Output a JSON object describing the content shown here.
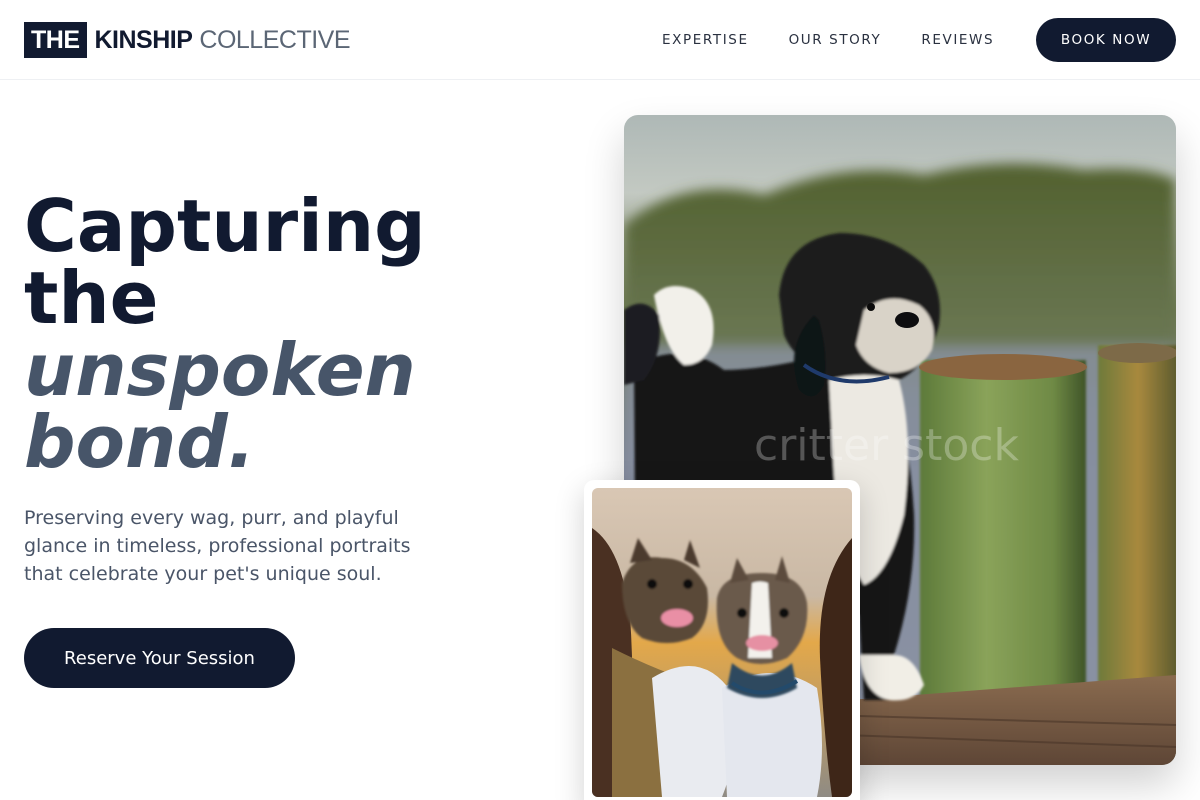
{
  "brand": {
    "mark": "THE",
    "strong": "KINSHIP",
    "light": "COLLECTIVE"
  },
  "nav": {
    "links": [
      "EXPERTISE",
      "OUR STORY",
      "REVIEWS"
    ],
    "cta_label": "BOOK NOW"
  },
  "hero": {
    "title_line1": "Capturing",
    "title_line2": "the",
    "title_line3": "unspoken",
    "title_line4": "bond.",
    "description": "Preserving every wag, purr, and playful glance in timeless, professional portraits that celebrate your pet's unique soul.",
    "cta_label": "Reserve Your Session"
  },
  "images": {
    "main_watermark": "critter stock",
    "main_subject": "black-and-white-dog-on-pier",
    "small_subject": "two-french-bulldogs-held-by-owners"
  },
  "colors": {
    "navy": "#111a30",
    "slate": "#475569",
    "body_text": "#4a5568"
  }
}
